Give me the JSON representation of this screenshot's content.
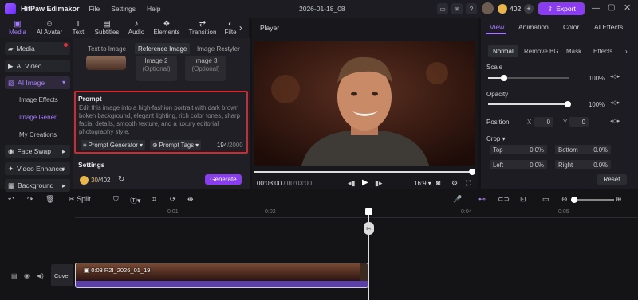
{
  "app": {
    "name": "HitPaw Edimakor",
    "menus": [
      "File",
      "Settings",
      "Help"
    ],
    "window_title": "2026-01-18_08",
    "credits": "402",
    "export_label": "Export"
  },
  "toolbar": {
    "tools": [
      {
        "label": "Media",
        "icon": "media-icon"
      },
      {
        "label": "AI Avatar",
        "icon": "avatar-icon"
      },
      {
        "label": "Text",
        "icon": "text-icon"
      },
      {
        "label": "Subtitles",
        "icon": "subtitles-icon"
      },
      {
        "label": "Audio",
        "icon": "audio-icon"
      },
      {
        "label": "Elements",
        "icon": "elements-icon"
      },
      {
        "label": "Transition",
        "icon": "transition-icon"
      },
      {
        "label": "Filte",
        "icon": "filter-icon"
      }
    ]
  },
  "sidebar": {
    "items": [
      "Media",
      "AI Video",
      "AI Image",
      "Face Swap",
      "Video Enhancer",
      "Background"
    ],
    "sub_items": [
      "Image Effects",
      "Image Gener...",
      "My Creations"
    ]
  },
  "panel": {
    "tabs": [
      "Text to Image",
      "Reference Image",
      "Image Restyler"
    ],
    "ref_images": [
      {
        "name": "Image 2",
        "note": "(Optional)"
      },
      {
        "name": "Image 3",
        "note": "(Optional)"
      }
    ],
    "prompt_label": "Prompt",
    "prompt_text": "Edit this image into a high-fashion portrait with dark brown bokeh background, elegant lighting, rich color tones, sharp facial details, smooth texture, and a luxury editorial photography style.",
    "prompt_generator": "Prompt Generator",
    "prompt_tags": "Prompt Tags",
    "char_count": "194",
    "char_max": "/2000",
    "settings_label": "Settings",
    "credits_used": "30",
    "credits_total": "/402",
    "generate_label": "Generate"
  },
  "player": {
    "label": "Player",
    "time_current": "00:03:00",
    "time_total": "/ 00:03:00",
    "aspect": "16:9"
  },
  "properties": {
    "tabs": [
      "View",
      "Animation",
      "Color",
      "AI Effects"
    ],
    "subtabs": [
      "Normal",
      "Remove BG",
      "Mask",
      "Effects"
    ],
    "scale_label": "Scale",
    "scale_value": "100%",
    "opacity_label": "Opacity",
    "opacity_value": "100%",
    "position_label": "Position",
    "pos_x_label": "X",
    "pos_x": "0",
    "pos_y_label": "Y",
    "pos_y": "0",
    "crop_label": "Crop",
    "crop": [
      {
        "label": "Top",
        "value": "0.0%"
      },
      {
        "label": "Bottom",
        "value": "0.0%"
      },
      {
        "label": "Left",
        "value": "0.0%"
      },
      {
        "label": "Right",
        "value": "0.0%"
      }
    ],
    "reset_label": "Reset"
  },
  "timeline": {
    "split_label": "Split",
    "ticks": [
      "0:01",
      "0:02",
      "0:04",
      "0:05"
    ],
    "cover_label": "Cover",
    "clip_name": "0:03 R2I_2026_01_19"
  },
  "colors": {
    "accent": "#8a3cf0",
    "highlight": "#d8262e"
  }
}
